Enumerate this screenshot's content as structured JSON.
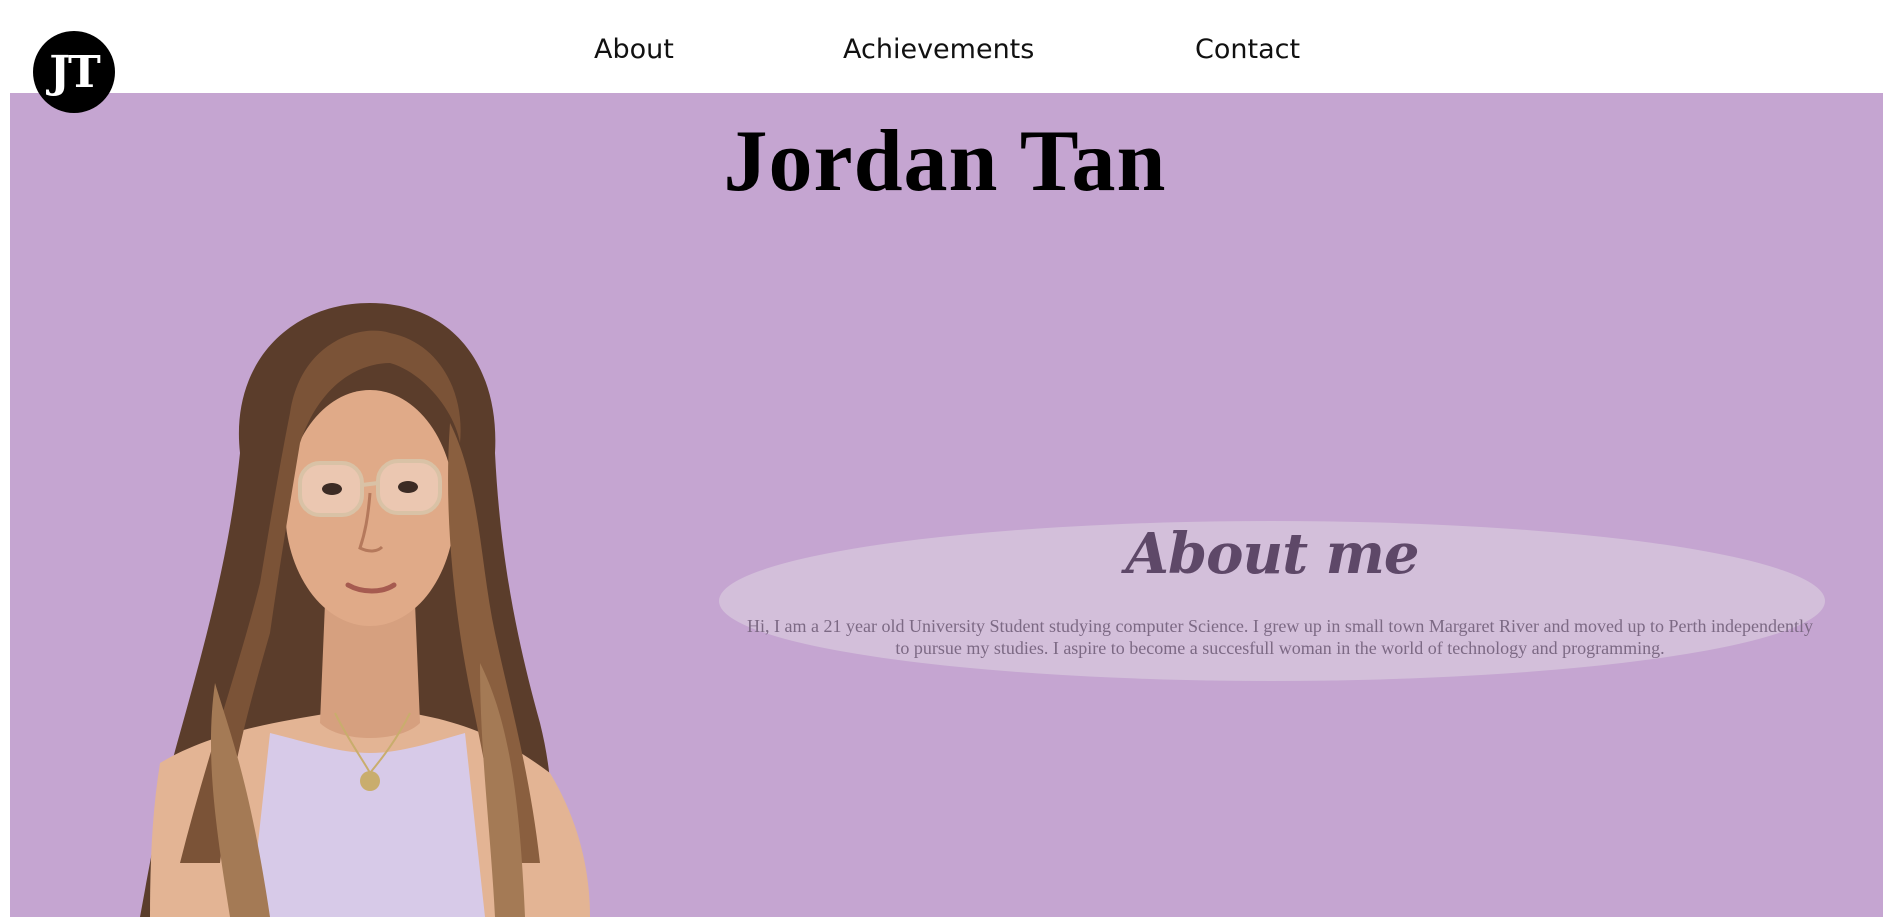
{
  "logo": {
    "text": "JT"
  },
  "nav": {
    "items": [
      {
        "label": "About"
      },
      {
        "label": "Achievements"
      },
      {
        "label": "Contact"
      }
    ]
  },
  "hero": {
    "name": "Jordan Tan",
    "background_color": "#c5a5d1"
  },
  "about": {
    "title": "About me",
    "text": "Hi, I am a 21 year old University Student studying computer Science. I grew up in small town Margaret River and moved up to Perth independently to pursue my studies. I aspire to become a succesfull woman in the world of technology and programming."
  }
}
